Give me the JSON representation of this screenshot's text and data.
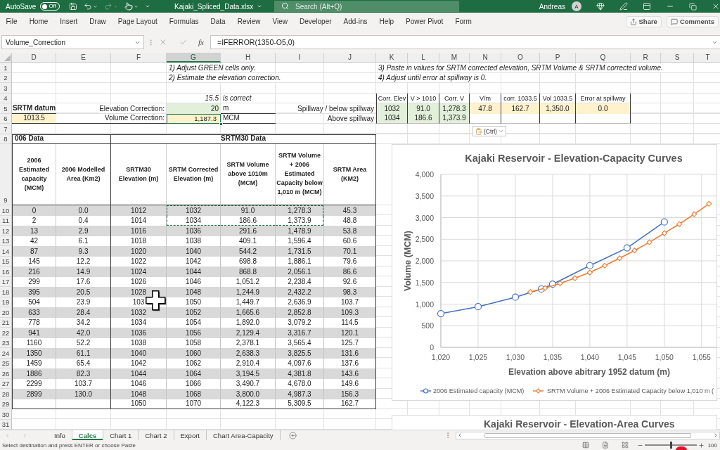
{
  "title_bar": {
    "autosave": "AutoSave",
    "autosave_switch": {
      "label": "Off",
      "on": false
    },
    "quick_access": [
      {
        "kind": "save",
        "disabled": false
      },
      {
        "kind": "undo",
        "disabled": false
      },
      {
        "kind": "redo",
        "disabled": true
      },
      {
        "kind": "touch",
        "disabled": false
      }
    ],
    "filename": "Kajaki_Spliced_Data.xlsx",
    "search": {
      "placeholder": "Search (Alt+Q)"
    },
    "user": "Andreas",
    "avatar": "A"
  },
  "ribbon": {
    "tabs": [
      "File",
      "Home",
      "Insert",
      "Draw",
      "Page Layout",
      "Formulas",
      "Data",
      "Review",
      "View",
      "Developer",
      "Add-ins",
      "Help",
      "Power Pivot",
      "Form"
    ],
    "buttons": [
      {
        "kind": "share",
        "label": "Share"
      },
      {
        "kind": "comments",
        "label": "Comments"
      }
    ]
  },
  "formula_bar": {
    "name_box": "Volume_Correction",
    "function_label": "fx",
    "formula": "=IFERROR(1350-O5,0)"
  },
  "columns": [
    {
      "label": "D",
      "selected": false
    },
    {
      "label": "E",
      "selected": false
    },
    {
      "label": "F",
      "selected": false
    },
    {
      "label": "G",
      "selected": true
    },
    {
      "label": "H",
      "selected": false
    },
    {
      "label": "I",
      "selected": false
    },
    {
      "label": "J",
      "selected": false
    },
    {
      "label": "K",
      "selected": false
    },
    {
      "label": "L",
      "selected": false
    },
    {
      "label": "M",
      "selected": false
    },
    {
      "label": "N",
      "selected": false
    },
    {
      "label": "O",
      "selected": false
    },
    {
      "label": "P",
      "selected": false
    },
    {
      "label": "Q",
      "selected": false
    },
    {
      "label": "R",
      "selected": false
    },
    {
      "label": "S",
      "selected": false
    },
    {
      "label": "T",
      "selected": false
    }
  ],
  "row_numbers": [
    "1",
    "2",
    "3",
    "4",
    "5",
    "6",
    "7",
    "8",
    "9",
    "10",
    "11",
    "12",
    "13",
    "14",
    "15",
    "16",
    "17",
    "18",
    "19",
    "20",
    "21",
    "22",
    "23",
    "24",
    "25",
    "26",
    "27",
    "28",
    "29",
    "30",
    "31"
  ],
  "notes": [
    "1) Adjust GREEN cells only.",
    "2) Estimate the elevation correction.",
    "3) Paste in values for SRTM corrected elevation, SRTM Volume & SRTM corrected volume.",
    "4) Adjust until error at spillway is 0."
  ],
  "check": {
    "value": "15.5",
    "label": "is correct"
  },
  "datum": {
    "label": "SRTM datum",
    "value": "1013.5",
    "kind": "result"
  },
  "corrections": [
    {
      "label": "Elevation Correction:",
      "value": "20",
      "unit": "m",
      "kind": "input",
      "selected": false
    },
    {
      "label": "Volume Correction:",
      "value": "1,187.3",
      "unit": "MCM",
      "kind": "result",
      "selected": true
    }
  ],
  "spillway": {
    "columns": [
      "Corr. Elev",
      "V > 1010",
      "Corr. V",
      "V/m",
      "corr. 1033.5",
      "Vol 1033.5",
      "Error at spillway"
    ],
    "rows": [
      {
        "label": "Spillway / below spillway",
        "cells": [
          {
            "value": "1032",
            "kind": "input"
          },
          {
            "value": "91.0",
            "kind": "input"
          },
          {
            "value": "1,278.3",
            "kind": "input"
          },
          {
            "value": "47.8",
            "kind": "result"
          },
          {
            "value": "162.7",
            "kind": "result"
          },
          {
            "value": "1,350.0",
            "kind": "result"
          },
          {
            "value": "0.0",
            "kind": "result"
          }
        ]
      },
      {
        "label": "Above spillway",
        "cells": [
          {
            "value": "1034",
            "kind": "input"
          },
          {
            "value": "186.6",
            "kind": "input"
          },
          {
            "value": "1,373.9",
            "kind": "input"
          }
        ]
      }
    ]
  },
  "paste_options": {
    "label": "(Ctrl)"
  },
  "data_table": {
    "groups": [
      "006 Data",
      "SRTM30 Data"
    ],
    "columns": [
      "2006 Estimated capacity (MCM)",
      "2006 Modelled Area (Km2)",
      "SRTM30 Elevation (m)",
      "SRTM Corrected Elevation (m)",
      "SRTM Volume above 1010m (MCM)",
      "SRTM Volume + 2006 Estimated Capacity below 1,010 m (MCM)",
      "SRTM Area (KM2)"
    ],
    "rows": [
      {
        "capacity": "0",
        "area": "0.0",
        "elevation": "1012",
        "corrected_elevation": "1032",
        "volume": "91.0",
        "total_volume": "1,278.3",
        "srtm_area": "45.3",
        "copied": true
      },
      {
        "capacity": "2",
        "area": "0.4",
        "elevation": "1014",
        "corrected_elevation": "1034",
        "volume": "186.6",
        "total_volume": "1,373.9",
        "srtm_area": "48.8",
        "copied": true
      },
      {
        "capacity": "13",
        "area": "2.9",
        "elevation": "1016",
        "corrected_elevation": "1036",
        "volume": "291.6",
        "total_volume": "1,478.9",
        "srtm_area": "53.8",
        "copied": false
      },
      {
        "capacity": "42",
        "area": "6.1",
        "elevation": "1018",
        "corrected_elevation": "1038",
        "volume": "409.1",
        "total_volume": "1,596.4",
        "srtm_area": "60.6",
        "copied": false
      },
      {
        "capacity": "87",
        "area": "9.3",
        "elevation": "1020",
        "corrected_elevation": "1040",
        "volume": "544.2",
        "total_volume": "1,731.5",
        "srtm_area": "70.1",
        "copied": false
      },
      {
        "capacity": "145",
        "area": "12.2",
        "elevation": "1022",
        "corrected_elevation": "1042",
        "volume": "698.8",
        "total_volume": "1,886.1",
        "srtm_area": "79.6",
        "copied": false
      },
      {
        "capacity": "216",
        "area": "14.9",
        "elevation": "1024",
        "corrected_elevation": "1044",
        "volume": "868.8",
        "total_volume": "2,056.1",
        "srtm_area": "86.6",
        "copied": false
      },
      {
        "capacity": "299",
        "area": "17.6",
        "elevation": "1026",
        "corrected_elevation": "1046",
        "volume": "1,051.2",
        "total_volume": "2,238.4",
        "srtm_area": "92.6",
        "copied": false
      },
      {
        "capacity": "395",
        "area": "20.5",
        "elevation": "1028",
        "corrected_elevation": "1048",
        "volume": "1,244.9",
        "total_volume": "2,432.2",
        "srtm_area": "98.3",
        "copied": false
      },
      {
        "capacity": "504",
        "area": "23.9",
        "elevation": "103",
        "corrected_elevation": "1050",
        "volume": "1,449.7",
        "total_volume": "2,636.9",
        "srtm_area": "103.7",
        "copied": false
      },
      {
        "capacity": "633",
        "area": "28.4",
        "elevation": "1032",
        "corrected_elevation": "1052",
        "volume": "1,665.6",
        "total_volume": "2,852.8",
        "srtm_area": "109.3",
        "copied": false
      },
      {
        "capacity": "778",
        "area": "34.2",
        "elevation": "1034",
        "corrected_elevation": "1054",
        "volume": "1,892.0",
        "total_volume": "3,079.2",
        "srtm_area": "114.5",
        "copied": false
      },
      {
        "capacity": "941",
        "area": "42.0",
        "elevation": "1036",
        "corrected_elevation": "1056",
        "volume": "2,129.4",
        "total_volume": "3,316.7",
        "srtm_area": "120.1",
        "copied": false
      },
      {
        "capacity": "1160",
        "area": "52.2",
        "elevation": "1038",
        "corrected_elevation": "1058",
        "volume": "2,378.1",
        "total_volume": "3,565.4",
        "srtm_area": "125.7",
        "copied": false
      },
      {
        "capacity": "1350",
        "area": "61.1",
        "elevation": "1040",
        "corrected_elevation": "1060",
        "volume": "2,638.3",
        "total_volume": "3,825.5",
        "srtm_area": "131.6",
        "copied": false
      },
      {
        "capacity": "1459",
        "area": "65.4",
        "elevation": "1042",
        "corrected_elevation": "1062",
        "volume": "2,910.4",
        "total_volume": "4,097.6",
        "srtm_area": "137.6",
        "copied": false
      },
      {
        "capacity": "1886",
        "area": "82.3",
        "elevation": "1044",
        "corrected_elevation": "1064",
        "volume": "3,194.5",
        "total_volume": "4,381.8",
        "srtm_area": "143.6",
        "copied": false
      },
      {
        "capacity": "2299",
        "area": "103.7",
        "elevation": "1046",
        "corrected_elevation": "1066",
        "volume": "3,490.7",
        "total_volume": "4,678.0",
        "srtm_area": "149.6",
        "copied": false
      },
      {
        "capacity": "2899",
        "area": "130.0",
        "elevation": "1048",
        "corrected_elevation": "1068",
        "volume": "3,800.0",
        "total_volume": "4,987.3",
        "srtm_area": "156.3",
        "copied": false
      },
      {
        "elevation": "1050",
        "corrected_elevation": "1070",
        "volume": "4,122.3",
        "total_volume": "5,309.5",
        "srtm_area": "162.7",
        "copied": false
      }
    ]
  },
  "capacity_chart": {
    "chart_data": {
      "type": "line",
      "title": "Kajaki Reservoir - Elevation-Capacity Curves",
      "xlabel": "Elevation above abitrary 1952 datum (m)",
      "ylabel": "Volume (MCM)",
      "grid": true,
      "legend": true,
      "x": [
        1020,
        1025,
        1030,
        1032,
        1033.5,
        1034,
        1035,
        1036,
        1038,
        1040,
        1042,
        1044,
        1045,
        1046,
        1048,
        1050,
        1052,
        1054,
        1056
      ],
      "series": [
        {
          "name": "2006 Estimated capacity (MCM)",
          "color": "#4472c4",
          "marker": "circle",
          "values": [
            780,
            940,
            1160,
            null,
            1350,
            null,
            1460,
            null,
            null,
            1890,
            null,
            null,
            2300,
            null,
            null,
            2900,
            null,
            null,
            null
          ]
        },
        {
          "name": "SRTM Volume + 2006 Estimated Capacity below 1,010 m (",
          "color": "#ed7d31",
          "marker": "diamond",
          "values": [
            null,
            null,
            null,
            1280,
            null,
            1370,
            null,
            1480,
            1600,
            1730,
            1890,
            2060,
            null,
            2240,
            2430,
            2640,
            2850,
            3080,
            3320
          ]
        }
      ],
      "xlim": [
        1020,
        1057
      ],
      "ylim": [
        0,
        4000
      ],
      "xticks": [
        {
          "value": 1020,
          "label": "1,020"
        },
        {
          "value": 1025,
          "label": "1,025"
        },
        {
          "value": 1030,
          "label": "1,030"
        },
        {
          "value": 1035,
          "label": "1,035"
        },
        {
          "value": 1040,
          "label": "1,040"
        },
        {
          "value": 1045,
          "label": "1,045"
        },
        {
          "value": 1050,
          "label": "1,050"
        },
        {
          "value": 1055,
          "label": "1,055"
        }
      ],
      "yticks": [
        {
          "value": 0,
          "label": "0"
        },
        {
          "value": 500,
          "label": "500"
        },
        {
          "value": 1000,
          "label": "1,000"
        },
        {
          "value": 1500,
          "label": "1,500"
        },
        {
          "value": 2000,
          "label": "2,000"
        },
        {
          "value": 2500,
          "label": "2,500"
        },
        {
          "value": 3000,
          "label": "3,000"
        },
        {
          "value": 3500,
          "label": "3,500"
        },
        {
          "value": 4000,
          "label": "4,000"
        }
      ]
    }
  },
  "area_chart": {
    "title": "Kajaki Reservoir - Elevation-Area Curves"
  },
  "sheet_tabs": [
    {
      "label": "Info",
      "selected": false
    },
    {
      "label": "Calcs",
      "selected": true
    },
    {
      "label": "Chart 1",
      "selected": false
    },
    {
      "label": "Chart 2",
      "selected": false
    },
    {
      "label": "Export",
      "selected": false
    },
    {
      "label": "Chart Area-Capacity",
      "selected": false
    }
  ],
  "status_bar": {
    "message": "Select destination and press ENTER or choose Paste",
    "zoom_slider": {
      "level": 0.5
    },
    "zoom": "100"
  }
}
